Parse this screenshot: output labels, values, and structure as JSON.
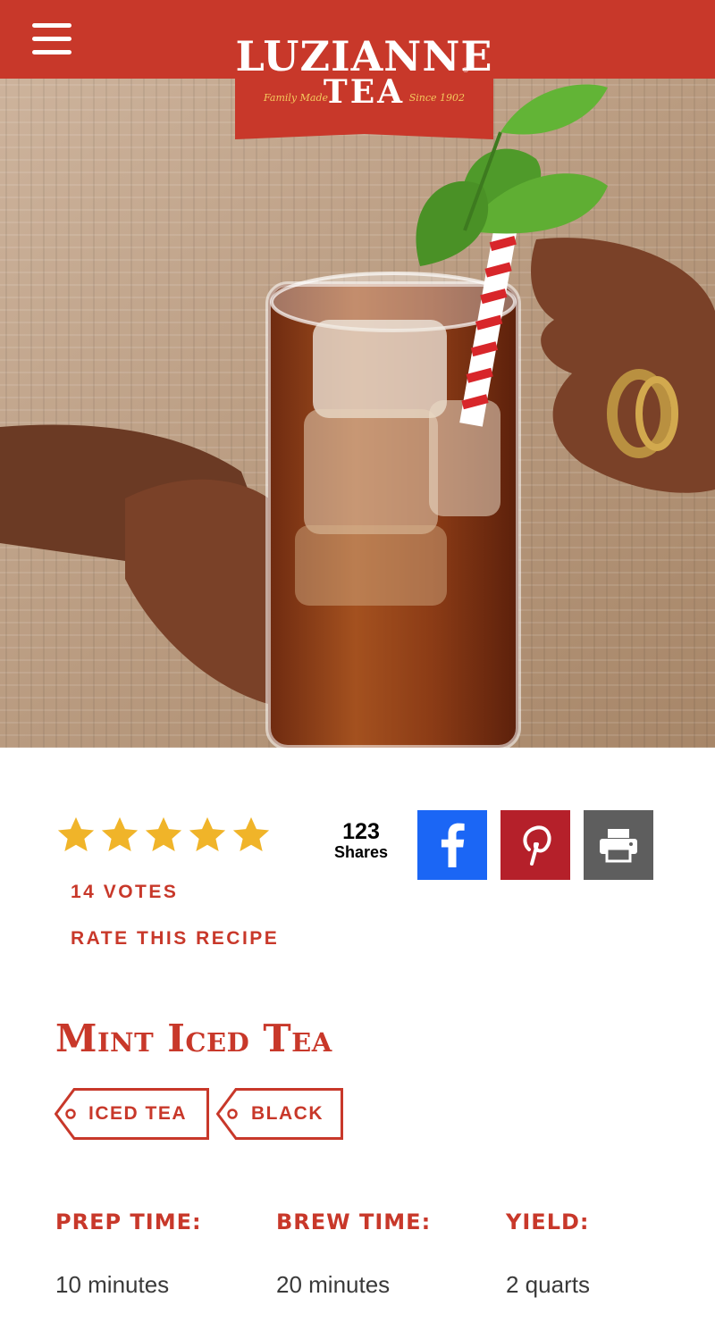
{
  "brand": {
    "name_top": "LUZIANNE",
    "name_bottom": "TEA",
    "tagline_left": "Family Made",
    "tagline_right": "Since 1902",
    "registered_mark": "®",
    "bar_color": "#c8382a"
  },
  "menu": {
    "icon": "hamburger-menu-icon"
  },
  "hero": {
    "image": "hand-holding-mint-iced-tea-glass"
  },
  "rating": {
    "stars": 5,
    "max": 5,
    "star_color": "#f0b429",
    "votes_label": "14 VOTES",
    "rate_label": "RATE THIS RECIPE"
  },
  "share": {
    "count": "123",
    "count_label": "Shares",
    "buttons": [
      {
        "icon": "facebook-icon",
        "color": "#1b66f5"
      },
      {
        "icon": "pinterest-icon",
        "color": "#b5202a"
      },
      {
        "icon": "printer-icon",
        "color": "#5e5e5e"
      }
    ]
  },
  "recipe": {
    "title": "Mint Iced Tea",
    "tags": [
      "ICED TEA",
      "BLACK"
    ],
    "meta": [
      {
        "label": "PREP TIME:",
        "value": "10 minutes"
      },
      {
        "label": "BREW TIME:",
        "value": "20 minutes"
      },
      {
        "label": "YIELD:",
        "value": "2 quarts"
      }
    ]
  }
}
